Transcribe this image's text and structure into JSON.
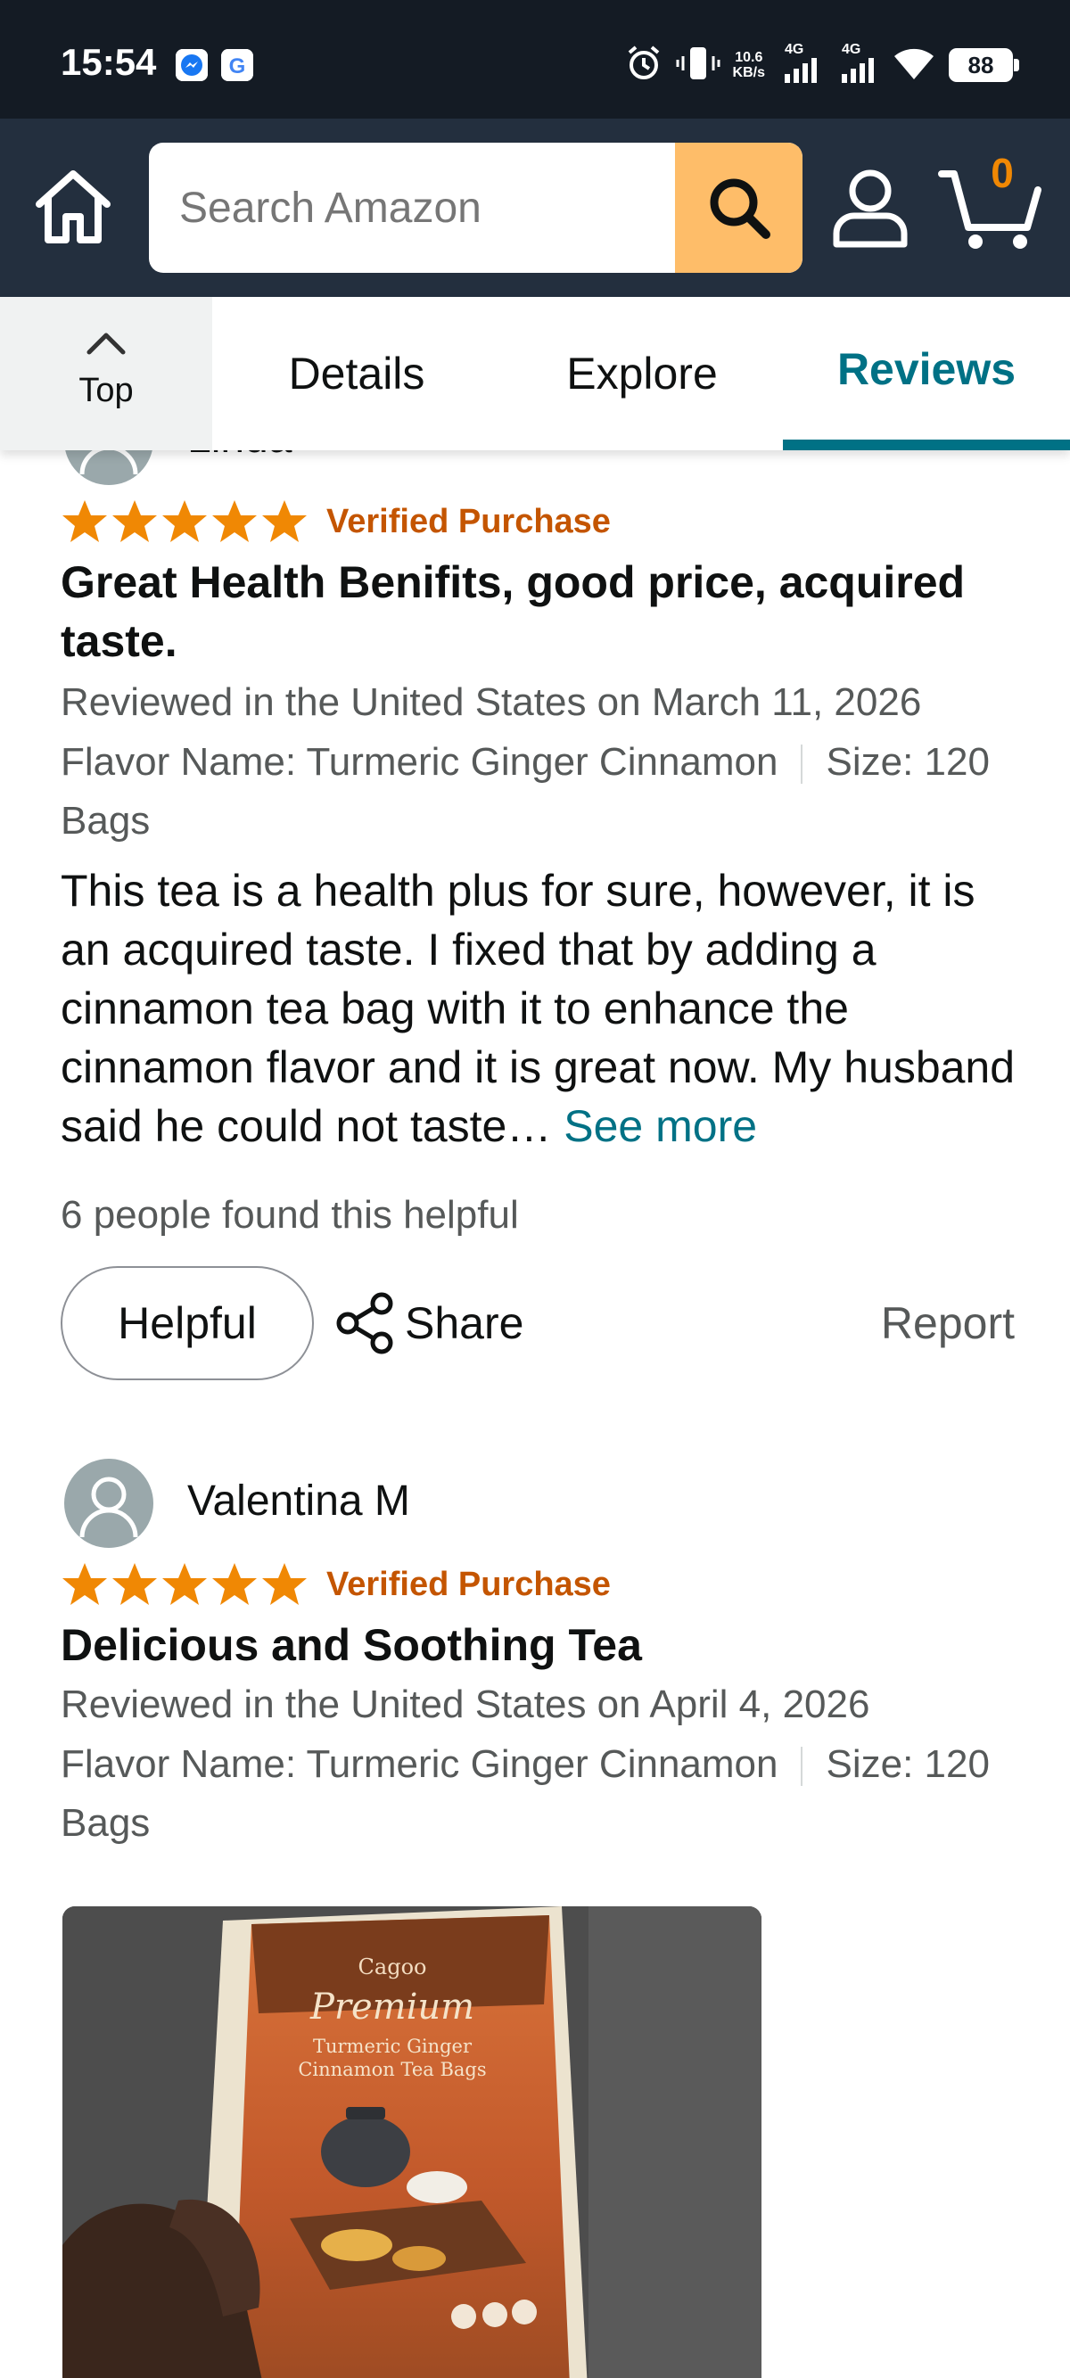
{
  "status_bar": {
    "time": "15:54",
    "net_speed_value": "10.6",
    "net_speed_unit": "KB/s",
    "signal_1_label": "4G",
    "signal_2_label": "4G",
    "battery": "88",
    "icons": [
      "messenger-icon",
      "google-icon",
      "alarm-icon",
      "vibrate-icon",
      "signal-icon",
      "wifi-icon",
      "battery-icon"
    ]
  },
  "header": {
    "search_placeholder": "Search Amazon",
    "cart_count": "0",
    "colors": {
      "header_bg": "#232f3e",
      "search_button": "#febd69",
      "cart_count": "#f08804"
    }
  },
  "tabs": {
    "top_label": "Top",
    "items": [
      {
        "label": "Details",
        "active": false
      },
      {
        "label": "Explore",
        "active": false
      },
      {
        "label": "Reviews",
        "active": true
      }
    ],
    "active_color": "#007185"
  },
  "reviews": [
    {
      "reviewer": "Linda",
      "rating": 5,
      "verified_label": "Verified Purchase",
      "title": "Great Health Benifits, good price, acquired taste.",
      "date": "Reviewed in the United States on March 11, 2026",
      "flavor": "Flavor Name: Turmeric Ginger Cinnamon",
      "size": "Size: 120 Bags",
      "body": "This tea is a health plus for sure, however, it is an acquired taste. I fixed that by adding a cinnamon tea bag with it to enhance the cinnamon flavor and it is great now. My husband said he could not taste…",
      "see_more": "See more",
      "helpful_count": "6 people found this helpful",
      "helpful_button": "Helpful",
      "share_label": "Share",
      "report_label": "Report"
    },
    {
      "reviewer": "Valentina M",
      "rating": 5,
      "verified_label": "Verified Purchase",
      "title": "Delicious and Soothing Tea",
      "date": "Reviewed in the United States on April 4, 2026",
      "flavor": "Flavor Name: Turmeric Ginger Cinnamon",
      "size": "Size: 120 Bags",
      "photo": {
        "brand": "Cagoo",
        "line1": "Premium",
        "line2": "Turmeric Ginger",
        "line3": "Cinnamon Tea Bags"
      }
    }
  ],
  "colors": {
    "star": "#f08804",
    "verified": "#c45500",
    "link": "#007185",
    "muted_text": "#565959"
  }
}
